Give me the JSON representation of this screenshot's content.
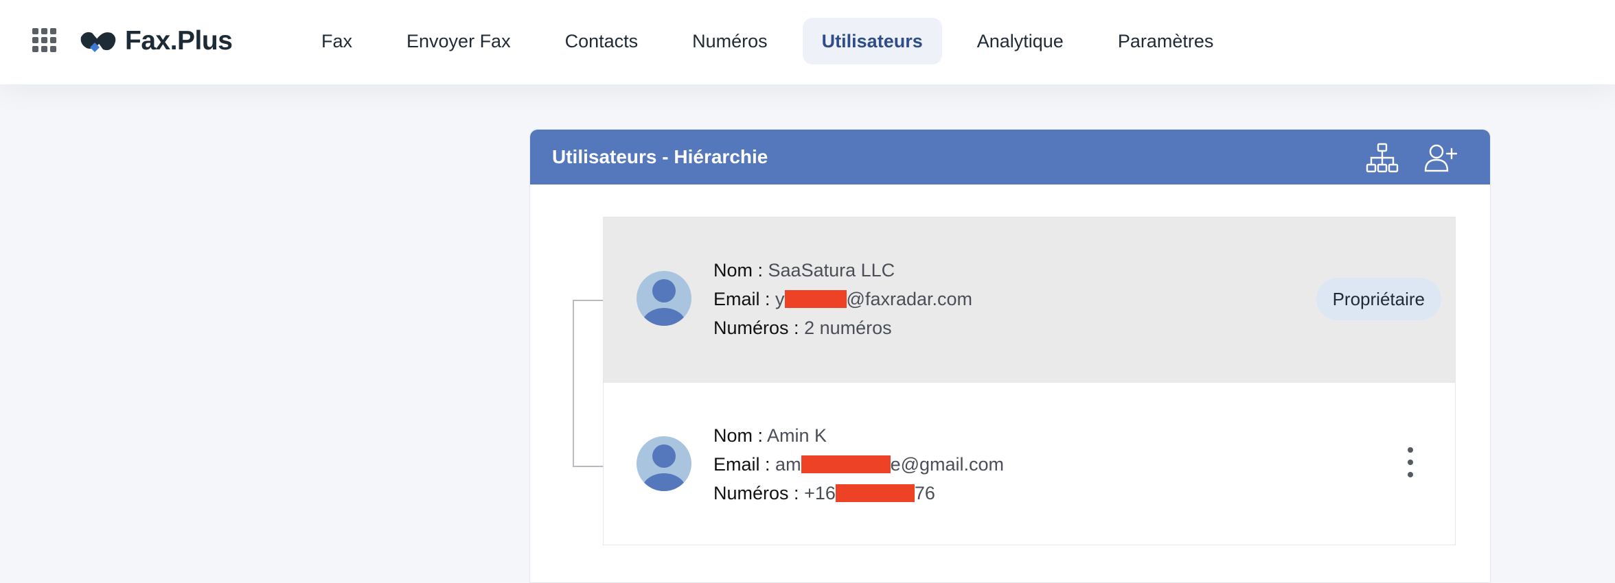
{
  "brand": {
    "name": "Fax.Plus"
  },
  "nav": {
    "items": [
      {
        "label": "Fax"
      },
      {
        "label": "Envoyer Fax"
      },
      {
        "label": "Contacts"
      },
      {
        "label": "Numéros"
      },
      {
        "label": "Utilisateurs",
        "active": true
      },
      {
        "label": "Analytique"
      },
      {
        "label": "Paramètres"
      }
    ]
  },
  "panel": {
    "title": "Utilisateurs - Hiérarchie",
    "icons": [
      "hierarchy-icon",
      "add-user-icon"
    ]
  },
  "users": [
    {
      "name_label": "Nom :",
      "name": "SaaSatura LLC",
      "email_label": "Email :",
      "email_prefix": "y",
      "email_suffix": "@faxradar.com",
      "numbers_label": "Numéros :",
      "numbers": "2 numéros",
      "role": "Propriétaire"
    },
    {
      "name_label": "Nom :",
      "name": "Amin K",
      "email_label": "Email :",
      "email_prefix": "am",
      "email_suffix": "e@gmail.com",
      "numbers_label": "Numéros :",
      "numbers_prefix": "+16",
      "numbers_suffix": "76"
    }
  ],
  "colors": {
    "header": "#5577bb",
    "active_nav_bg": "#eef2f8",
    "owner_row_bg": "#eaeaea",
    "badge_bg": "#dce7f3",
    "redaction": "#ee4227"
  }
}
